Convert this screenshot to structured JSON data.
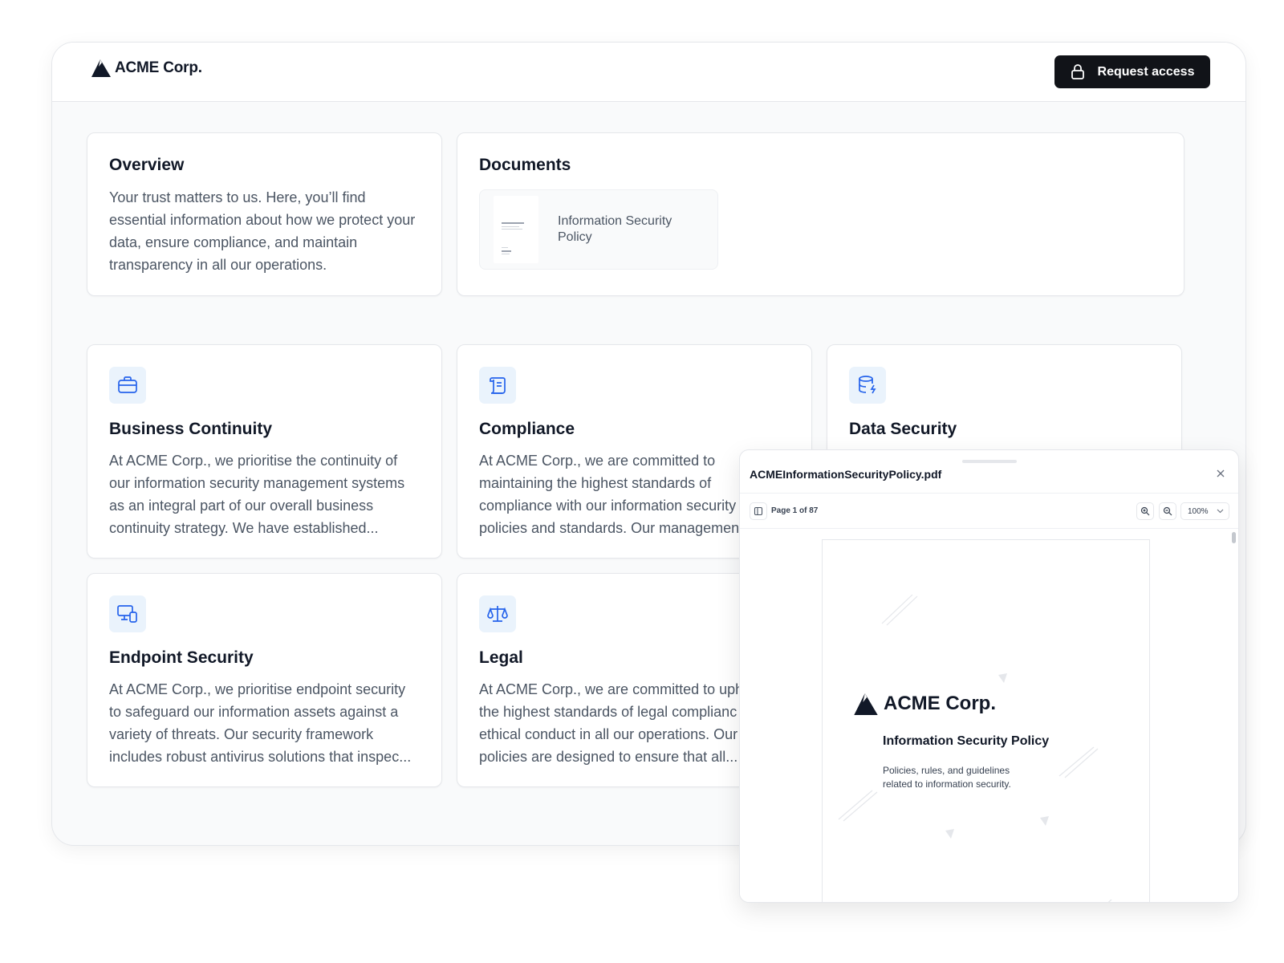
{
  "header": {
    "brand": "ACME Corp.",
    "request_access_label": "Request access"
  },
  "overview": {
    "title": "Overview",
    "text": "Your trust matters to us. Here, you’ll find essential information about how we protect your data, ensure compliance, and maintain transparency in all our operations."
  },
  "documents": {
    "title": "Documents",
    "items": [
      {
        "title": "Information Security Policy"
      }
    ]
  },
  "features": [
    {
      "icon": "briefcase-icon",
      "title": "Business Continuity",
      "lines": [
        "At ACME Corp., we prioritise the continuity of",
        "our information security management systems",
        "as an integral part of our overall business",
        "continuity strategy. We have established..."
      ]
    },
    {
      "icon": "scroll-icon",
      "title": "Compliance",
      "lines": [
        "At ACME Corp., we are committed to",
        "maintaining the highest standards of",
        "compliance with our information security",
        "policies and standards. Our managemen"
      ]
    },
    {
      "icon": "database-bolt-icon",
      "title": "Data Security",
      "lines": []
    },
    {
      "icon": "devices-icon",
      "title": "Endpoint Security",
      "lines": [
        "At ACME Corp., we prioritise endpoint security",
        "to safeguard our information assets against a",
        "variety of threats. Our security framework",
        "includes robust antivirus solutions that inspec..."
      ]
    },
    {
      "icon": "scale-icon",
      "title": "Legal",
      "lines": [
        "At ACME Corp., we are committed to uph",
        "the highest standards of legal complianc",
        "ethical conduct in all our operations. Our",
        "policies are designed to ensure that all..."
      ]
    }
  ],
  "viewer": {
    "filename": "ACMEInformationSecurityPolicy.pdf",
    "page_info": "Page 1 of 87",
    "zoom": "100%",
    "page": {
      "brand": "ACME Corp.",
      "title": "Information Security Policy",
      "desc_lines": [
        "Policies, rules, and guidelines",
        "related to information security."
      ]
    }
  },
  "colors": {
    "accent_blue": "#2563eb",
    "icon_bg": "#eaf3fc",
    "button_dark": "#111318"
  }
}
